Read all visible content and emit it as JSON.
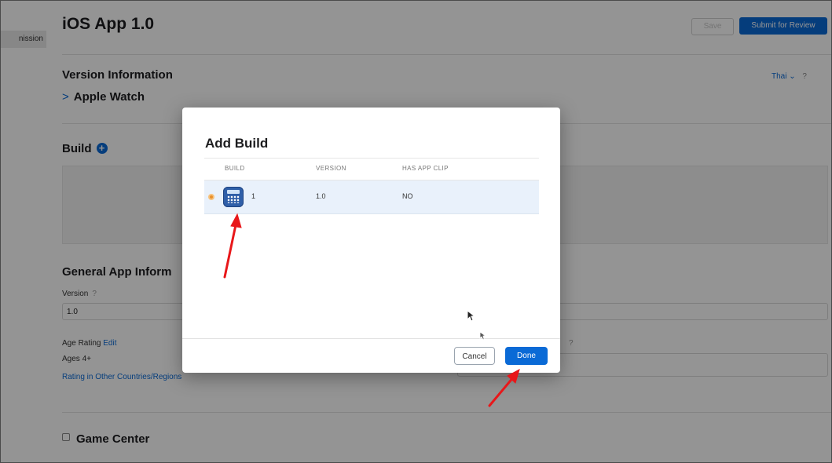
{
  "sidebar": {
    "selected_item": "nission"
  },
  "header": {
    "title": "iOS App 1.0",
    "save_label": "Save",
    "submit_label": "Submit for Review"
  },
  "version_info": {
    "title": "Version Information",
    "language": "Thai",
    "language_chevron": "⌄",
    "help": "?"
  },
  "apple_watch": {
    "chevron": ">",
    "label": "Apple Watch"
  },
  "build": {
    "title": "Build",
    "add_glyph": "+"
  },
  "general": {
    "title": "General App Inform",
    "version_label": "Version",
    "help": "?",
    "version_value": "1.0",
    "age_rating_label": "Age Rating",
    "age_rating_edit": "Edit",
    "ages_value": "Ages 4+",
    "rating_link": "Rating in Other Countries/Regions",
    "right_help": "?"
  },
  "game_center": {
    "label": "Game Center"
  },
  "modal": {
    "title": "Add Build",
    "columns": [
      "BUILD",
      "VERSION",
      "HAS APP CLIP"
    ],
    "row": {
      "build": "1",
      "version": "1.0",
      "has_app_clip": "NO",
      "icon": "calculator-app-icon"
    },
    "cancel_label": "Cancel",
    "done_label": "Done"
  },
  "colors": {
    "accent": "#0a6ad6",
    "radio": "#e8902c",
    "annotation_arrow": "#e8171a",
    "row_highlight": "#e9f1fb"
  }
}
